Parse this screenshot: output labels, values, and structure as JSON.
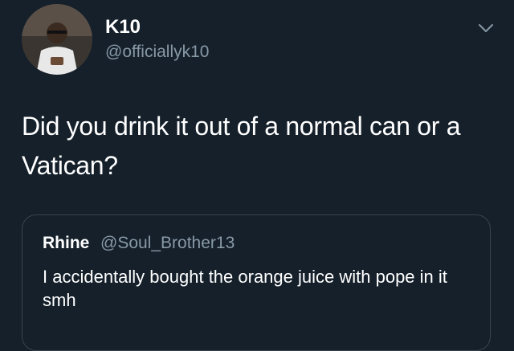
{
  "author": {
    "name": "K10",
    "handle": "@officiallyk10",
    "avatar_icon": "profile-photo"
  },
  "tweet": {
    "text": "Did you drink it out of a normal can or a Vatican?"
  },
  "menu_icon": "chevron-down-icon",
  "quoted_tweet": {
    "name": "Rhine",
    "handle": "@Soul_Brother13",
    "text": "I accidentally bought the orange juice with pope in it smh"
  },
  "colors": {
    "background": "#15202b",
    "text_primary": "#ffffff",
    "text_secondary": "#8899a6",
    "border": "#38444d"
  }
}
